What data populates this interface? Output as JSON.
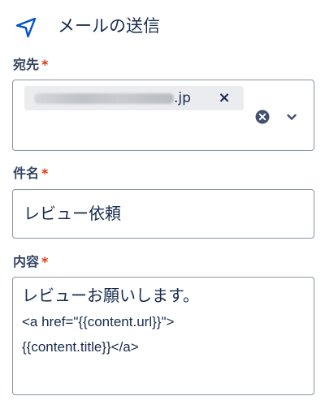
{
  "header": {
    "title": "メールの送信",
    "icon": "send-icon"
  },
  "fields": {
    "to": {
      "label": "宛先",
      "required_mark": "*",
      "chip_text": ".jp",
      "chip_remove": "×"
    },
    "subject": {
      "label": "件名",
      "required_mark": "*",
      "value": "レビュー依頼"
    },
    "body": {
      "label": "内容",
      "required_mark": "*",
      "lines": [
        "レビューお願いします。",
        "<a href=\"{{content.url}}\">",
        "{{content.title}}</a>"
      ]
    }
  },
  "colors": {
    "accent": "#0052cc",
    "required": "#de350b",
    "text": "#172b4d",
    "label": "#344563",
    "border": "#8993a4",
    "chip_bg": "#ebecf0"
  }
}
